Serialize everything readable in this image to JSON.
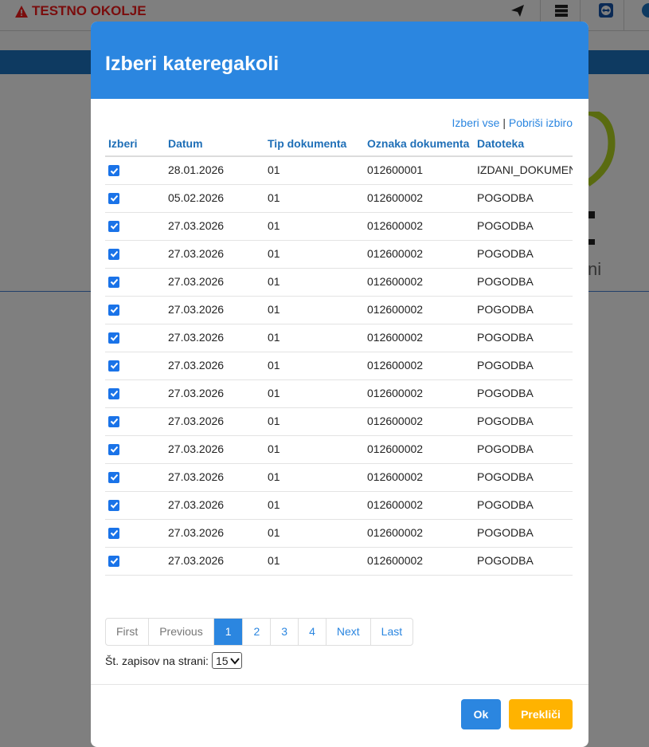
{
  "env_warning": "TESTNO OKOLJE",
  "topbar_icons": [
    "paper-plane-icon",
    "server-icon",
    "remote-support-icon",
    "info-icon"
  ],
  "modal": {
    "title": "Izberi kateregakoli",
    "select_all": "Izberi vse",
    "separator": "|",
    "clear_selection": "Pobriši izbiro",
    "columns": [
      "Izberi",
      "Datum",
      "Tip dokumenta",
      "Oznaka dokumenta",
      "Datoteka"
    ],
    "rows": [
      {
        "checked": true,
        "datum": "28.01.2026",
        "tip": "01",
        "oznaka": "012600001",
        "datoteka": "IZDANI_DOKUMENT"
      },
      {
        "checked": true,
        "datum": "05.02.2026",
        "tip": "01",
        "oznaka": "012600002",
        "datoteka": "POGODBA"
      },
      {
        "checked": true,
        "datum": "27.03.2026",
        "tip": "01",
        "oznaka": "012600002",
        "datoteka": "POGODBA"
      },
      {
        "checked": true,
        "datum": "27.03.2026",
        "tip": "01",
        "oznaka": "012600002",
        "datoteka": "POGODBA"
      },
      {
        "checked": true,
        "datum": "27.03.2026",
        "tip": "01",
        "oznaka": "012600002",
        "datoteka": "POGODBA"
      },
      {
        "checked": true,
        "datum": "27.03.2026",
        "tip": "01",
        "oznaka": "012600002",
        "datoteka": "POGODBA"
      },
      {
        "checked": true,
        "datum": "27.03.2026",
        "tip": "01",
        "oznaka": "012600002",
        "datoteka": "POGODBA"
      },
      {
        "checked": true,
        "datum": "27.03.2026",
        "tip": "01",
        "oznaka": "012600002",
        "datoteka": "POGODBA"
      },
      {
        "checked": true,
        "datum": "27.03.2026",
        "tip": "01",
        "oznaka": "012600002",
        "datoteka": "POGODBA"
      },
      {
        "checked": true,
        "datum": "27.03.2026",
        "tip": "01",
        "oznaka": "012600002",
        "datoteka": "POGODBA"
      },
      {
        "checked": true,
        "datum": "27.03.2026",
        "tip": "01",
        "oznaka": "012600002",
        "datoteka": "POGODBA"
      },
      {
        "checked": true,
        "datum": "27.03.2026",
        "tip": "01",
        "oznaka": "012600002",
        "datoteka": "POGODBA"
      },
      {
        "checked": true,
        "datum": "27.03.2026",
        "tip": "01",
        "oznaka": "012600002",
        "datoteka": "POGODBA"
      },
      {
        "checked": true,
        "datum": "27.03.2026",
        "tip": "01",
        "oznaka": "012600002",
        "datoteka": "POGODBA"
      },
      {
        "checked": true,
        "datum": "27.03.2026",
        "tip": "01",
        "oznaka": "012600002",
        "datoteka": "POGODBA"
      }
    ],
    "pagination": {
      "first": "First",
      "previous": "Previous",
      "pages": [
        "1",
        "2",
        "3",
        "4"
      ],
      "current": "1",
      "next": "Next",
      "last": "Last"
    },
    "per_page_label": "Št. zapisov na strani:",
    "per_page_value": "15",
    "ok_label": "Ok",
    "cancel_label": "Prekliči"
  },
  "colors": {
    "modal_header": "#2b86e0",
    "cancel_button": "#ffb300",
    "warning": "#7a0d0d"
  }
}
